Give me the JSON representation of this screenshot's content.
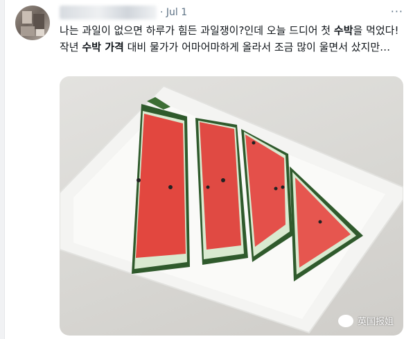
{
  "tweet": {
    "date": "· Jul 1",
    "more_icon": "more-horizontal-icon",
    "text_part1": "나는 과일이 없으면 하루가 힘든 과일쟁이?인데 오늘 드디어 첫 ",
    "text_bold1": "수박",
    "text_part2": "을 먹었다! 작년 ",
    "text_bold2": "수박 가격",
    "text_part3": " 대비 물가가 어마어마하게 올라서 조금 많이 울면서 샀지만…"
  },
  "photo": {
    "alt_subject": "watermelon-slices-on-plate"
  },
  "watermark": {
    "label": "英国报姐",
    "icon": "wechat-icon"
  },
  "colors": {
    "date_gray": "#5b7083",
    "text": "#0f1419"
  }
}
